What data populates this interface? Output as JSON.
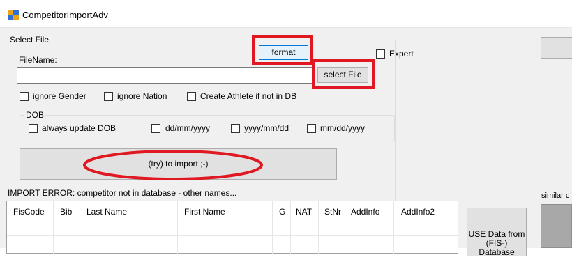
{
  "window": {
    "title": "CompetitorImportAdv"
  },
  "select_file_group": {
    "label": "Select File"
  },
  "filename": {
    "label": "FileName:",
    "value": ""
  },
  "format_button": {
    "label": "format"
  },
  "select_file_button": {
    "label": "select File"
  },
  "expert": {
    "label": "Expert",
    "checked": false
  },
  "options": {
    "ignore_gender": "ignore Gender",
    "ignore_nation": "ignore Nation",
    "create_athlete": "Create Athlete if not in DB"
  },
  "dob_group": {
    "label": "DOB",
    "always_update": "always update DOB",
    "fmt1": "dd/mm/yyyy",
    "fmt2": "yyyy/mm/dd",
    "fmt3": "mm/dd/yyyy"
  },
  "import_button": {
    "label": "(try) to import ;-)"
  },
  "error": {
    "text": "IMPORT ERROR: competitor not in database - other names..."
  },
  "grid": {
    "columns": [
      "FisCode",
      "Bib",
      "Last Name",
      "First Name",
      "G",
      "NAT",
      "StNr",
      "AddInfo",
      "AddInfo2"
    ]
  },
  "use_data_button": {
    "label": "USE Data from (FIS-) Database"
  },
  "similar": {
    "label": "similar c"
  },
  "colors": {
    "highlight": "#e01822",
    "window_bg": "#f0f0f0"
  }
}
